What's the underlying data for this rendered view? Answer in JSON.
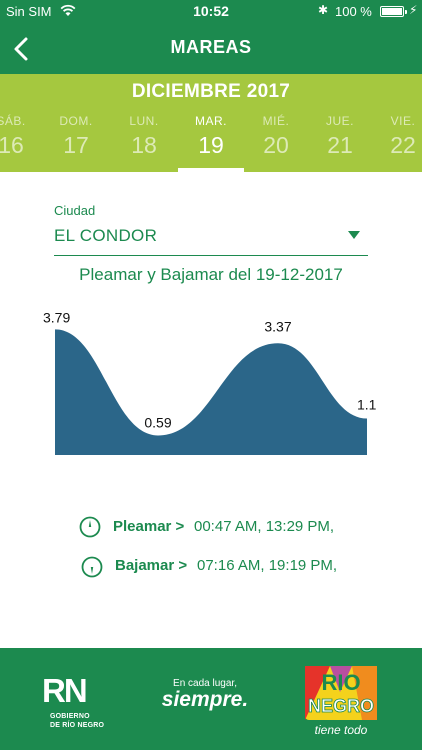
{
  "status_bar": {
    "carrier": "Sin SIM",
    "time": "10:52",
    "battery": "100 %"
  },
  "nav": {
    "title": "MAREAS",
    "back_icon": "chevron-left-icon"
  },
  "calendar": {
    "month": "DICIEMBRE 2017",
    "days": [
      {
        "name": "SÁB.",
        "num": "16"
      },
      {
        "name": "DOM.",
        "num": "17"
      },
      {
        "name": "LUN.",
        "num": "18"
      },
      {
        "name": "MAR.",
        "num": "19"
      },
      {
        "name": "MIÉ.",
        "num": "20"
      },
      {
        "name": "JUE.",
        "num": "21"
      },
      {
        "name": "VIE.",
        "num": "22"
      }
    ],
    "selected_index": 3
  },
  "city": {
    "label": "Ciudad",
    "value": "EL CONDOR"
  },
  "chart_title": "Pleamar y Bajamar del 19-12-2017",
  "chart_data": {
    "type": "area",
    "title": "Pleamar y Bajamar del 19-12-2017",
    "x": [
      0,
      1,
      2,
      3
    ],
    "values": [
      3.79,
      0.59,
      3.37,
      1.1
    ],
    "data_labels": [
      "3.79",
      "0.59",
      "3.37",
      "1.1"
    ],
    "ylim": [
      0,
      4
    ],
    "grid": false,
    "color": "#2b6689"
  },
  "schedule": {
    "pleamar": {
      "label": "Pleamar >",
      "times": "00:47 AM, 13:29 PM,"
    },
    "bajamar": {
      "label": "Bajamar >",
      "times": "07:16 AM, 19:19 PM,"
    }
  },
  "footer": {
    "rn_mark": "RN",
    "rn_sub_1": "GOBIERNO",
    "rn_sub_2": "DE RÍO NEGRO",
    "slogan_small": "En cada lugar,",
    "slogan_big": "siempre.",
    "badge_line_1": "RIO",
    "badge_line_2": "NEGRO",
    "badge_tag": "tiene todo"
  },
  "colors": {
    "primary": "#1c8a4f",
    "accent": "#a5c83f",
    "chart": "#2b6689"
  }
}
